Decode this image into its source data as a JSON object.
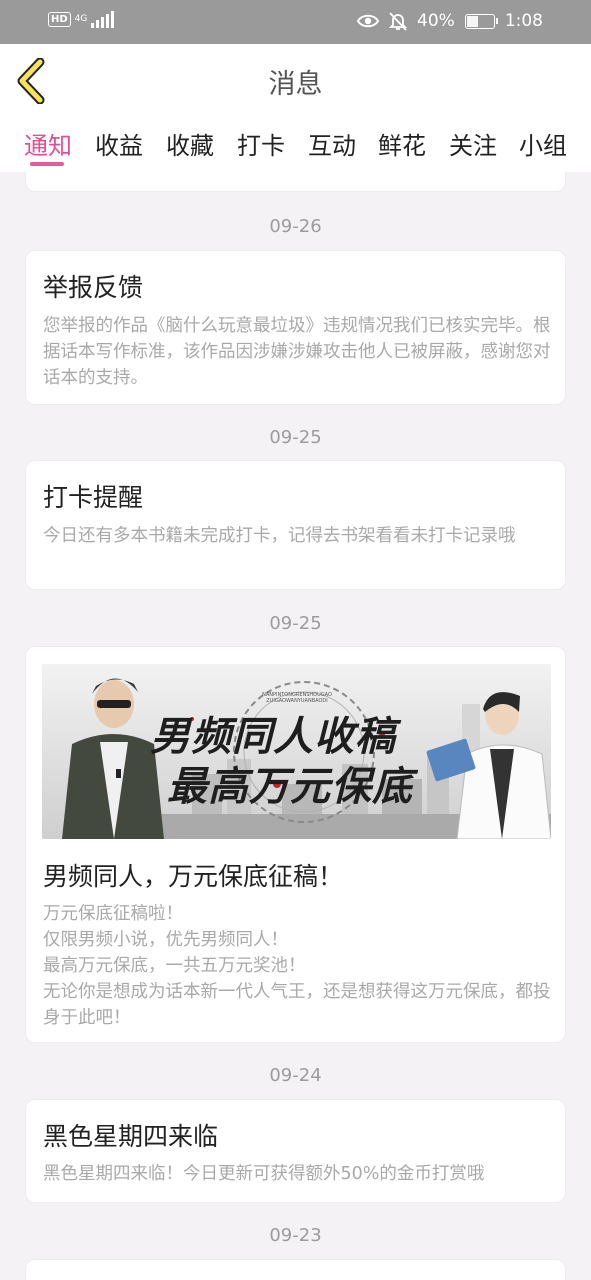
{
  "status_bar": {
    "hd": "HD",
    "network": "4G",
    "battery_text": "40%",
    "battery_level": 0.4,
    "time": "1:08"
  },
  "header": {
    "title": "消息"
  },
  "tabs": [
    {
      "label": "通知",
      "active": true
    },
    {
      "label": "收益"
    },
    {
      "label": "收藏"
    },
    {
      "label": "打卡"
    },
    {
      "label": "互动"
    },
    {
      "label": "鲜花"
    },
    {
      "label": "关注"
    },
    {
      "label": "小组"
    }
  ],
  "feed": [
    {
      "date": "09-26",
      "title": "举报反馈",
      "body": "您举报的作品《脑什么玩意最垃圾》违规情况我们已核实完毕。根据话本写作标准，该作品因涉嫌涉嫌攻击他人已被屏蔽，感谢您对话本的支持。"
    },
    {
      "date": "09-25",
      "title": "打卡提醒",
      "body": "今日还有多本书籍未完成打卡，记得去书架看看未打卡记录哦"
    },
    {
      "date": "09-25",
      "banner": {
        "line1": "男频同人收稿",
        "line2": "最高万元保底",
        "small_text": "NANPINTONGRENSHOUGAO ZUIGAOWANYUANBAODI"
      },
      "title": "男频同人，万元保底征稿！",
      "body_lines": [
        "万元保底征稿啦！",
        "仅限男频小说，优先男频同人！",
        "最高万元保底，一共五万元奖池！",
        "无论你是想成为话本新一代人气王，还是想获得这万元保底，都投身于此吧！"
      ]
    },
    {
      "date": "09-24",
      "title": "黑色星期四来临",
      "body": "黑色星期四来临！今日更新可获得额外50%的金币打赏哦"
    },
    {
      "date": "09-23"
    }
  ],
  "colors": {
    "accent": "#e2508f",
    "back_arrow_fill": "#f7e35a",
    "status_bar_bg": "#9a9a9a",
    "page_bg": "#f5f2f5"
  },
  "icons": {
    "back": "chevron-left-icon",
    "eye": "eye-icon",
    "bell_muted": "bell-off-icon",
    "battery": "battery-icon",
    "signal": "signal-icon"
  }
}
